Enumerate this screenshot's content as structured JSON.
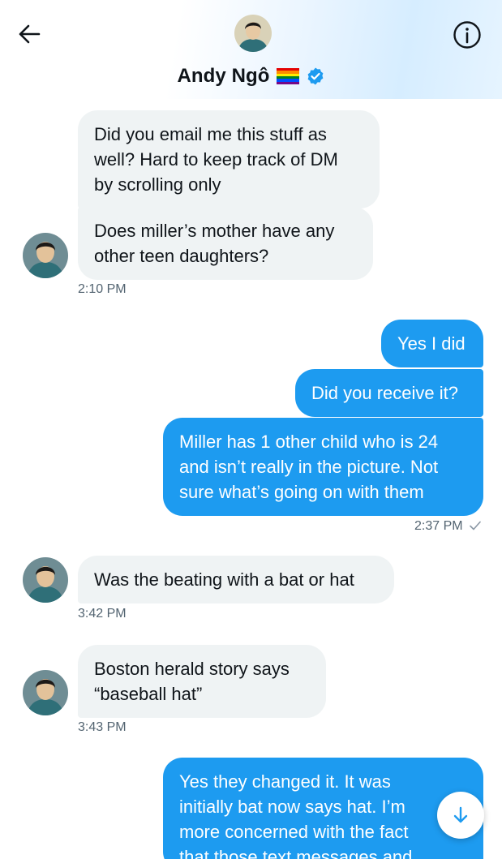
{
  "header": {
    "name": "Andy Ngô",
    "back_icon": "arrow-left-icon",
    "info_icon": "info-circle-icon",
    "flag": "rainbow-flag-emoji",
    "verified": "verified-badge-icon"
  },
  "colors": {
    "sent_bubble": "#1d9bf0",
    "received_bubble": "#eff3f4",
    "timestamp": "#536471",
    "verified": "#1d9bf0"
  },
  "messages": {
    "m1": "Did you email me this stuff as\nwell? Hard to keep track of DM\nby scrolling only",
    "m2": "Does miller’s mother have any\nother teen daughters?",
    "t1": "2:10 PM",
    "m3": "Yes I did",
    "m4": "Did you receive it?",
    "m5": "Miller has 1 other child who is 24\nand isn’t really in the picture. Not\nsure what’s going on with them",
    "t2": "2:37 PM",
    "m6": "Was the beating with a bat or hat",
    "t3": "3:42 PM",
    "m7": "Boston herald story says\n“baseball hat”",
    "t4": "3:43 PM",
    "m8": "Yes they changed it. It was\ninitially bat now says hat. I’m\nmore concerned with the fact\nthat those text messages and"
  },
  "scroll_down_icon": "arrow-down-icon"
}
